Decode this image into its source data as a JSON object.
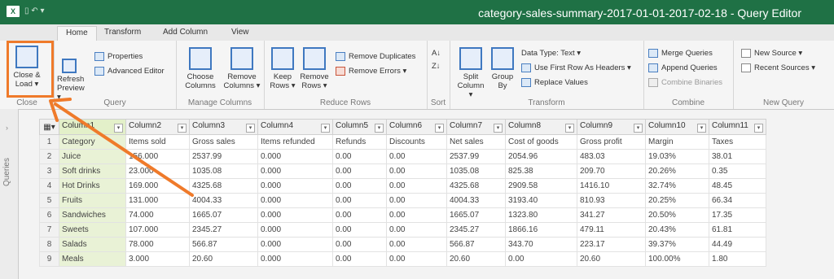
{
  "window": {
    "title": "category-sales-summary-2017-01-01-2017-02-18 - Query Editor",
    "app_icon": "X",
    "quick_access": "▯ ↶ ▾"
  },
  "ribbon_tabs": [
    "Home",
    "Transform",
    "Add Column",
    "View"
  ],
  "ribbon": {
    "close_group": {
      "label": "Close",
      "close_load": "Close &",
      "close_load2": "Load ▾"
    },
    "query_group": {
      "label": "Query",
      "refresh": "Refresh",
      "refresh2": "Preview ▾",
      "properties": "Properties",
      "advanced_editor": "Advanced Editor"
    },
    "manage_columns_group": {
      "label": "Manage Columns",
      "choose": "Choose",
      "choose2": "Columns",
      "remove": "Remove",
      "remove2": "Columns ▾"
    },
    "reduce_rows_group": {
      "label": "Reduce Rows",
      "keep": "Keep",
      "keep2": "Rows ▾",
      "remove": "Remove",
      "remove2": "Rows ▾",
      "remove_duplicates": "Remove Duplicates",
      "remove_errors": "Remove Errors ▾"
    },
    "sort_group": {
      "label": "Sort",
      "asc": "A↓",
      "desc": "Z↓"
    },
    "transform_group": {
      "label": "Transform",
      "split": "Split",
      "split2": "Column ▾",
      "group": "Group",
      "group2": "By",
      "data_type": "Data Type: Text ▾",
      "first_row": "Use First Row As Headers ▾",
      "replace": "Replace Values"
    },
    "combine_group": {
      "label": "Combine",
      "merge": "Merge Queries",
      "append": "Append Queries",
      "combine_binaries": "Combine Binaries"
    },
    "new_query_group": {
      "label": "New Query",
      "new_source": "New Source ▾",
      "recent_sources": "Recent Sources ▾"
    }
  },
  "sidebar": {
    "label": "Queries",
    "chevron": "›"
  },
  "table": {
    "corner": "▦▾",
    "columns": [
      "Column1",
      "Column2",
      "Column3",
      "Column4",
      "Column5",
      "Column6",
      "Column7",
      "Column8",
      "Column9",
      "Column10",
      "Column11"
    ],
    "rows": [
      {
        "n": "1",
        "cells": [
          "Category",
          "Items sold",
          "Gross sales",
          "Items refunded",
          "Refunds",
          "Discounts",
          "Net sales",
          "Cost of goods",
          "Gross profit",
          "Margin",
          "Taxes"
        ]
      },
      {
        "n": "2",
        "cells": [
          "Juice",
          "156.000",
          "2537.99",
          "0.000",
          "0.00",
          "0.00",
          "2537.99",
          "2054.96",
          "483.03",
          "19.03%",
          "38.01"
        ]
      },
      {
        "n": "3",
        "cells": [
          "Soft drinks",
          "23.000",
          "1035.08",
          "0.000",
          "0.00",
          "0.00",
          "1035.08",
          "825.38",
          "209.70",
          "20.26%",
          "0.35"
        ]
      },
      {
        "n": "4",
        "cells": [
          "Hot Drinks",
          "169.000",
          "4325.68",
          "0.000",
          "0.00",
          "0.00",
          "4325.68",
          "2909.58",
          "1416.10",
          "32.74%",
          "48.45"
        ]
      },
      {
        "n": "5",
        "cells": [
          "Fruits",
          "131.000",
          "4004.33",
          "0.000",
          "0.00",
          "0.00",
          "4004.33",
          "3193.40",
          "810.93",
          "20.25%",
          "66.34"
        ]
      },
      {
        "n": "6",
        "cells": [
          "Sandwiches",
          "74.000",
          "1665.07",
          "0.000",
          "0.00",
          "0.00",
          "1665.07",
          "1323.80",
          "341.27",
          "20.50%",
          "17.35"
        ]
      },
      {
        "n": "7",
        "cells": [
          "Sweets",
          "107.000",
          "2345.27",
          "0.000",
          "0.00",
          "0.00",
          "2345.27",
          "1866.16",
          "479.11",
          "20.43%",
          "61.81"
        ]
      },
      {
        "n": "8",
        "cells": [
          "Salads",
          "78.000",
          "566.87",
          "0.000",
          "0.00",
          "0.00",
          "566.87",
          "343.70",
          "223.17",
          "39.37%",
          "44.49"
        ]
      },
      {
        "n": "9",
        "cells": [
          "Meals",
          "3.000",
          "20.60",
          "0.000",
          "0.00",
          "0.00",
          "20.60",
          "0.00",
          "20.60",
          "100.00%",
          "1.80"
        ]
      }
    ]
  },
  "annotation": {
    "color": "#ef7a2a"
  }
}
